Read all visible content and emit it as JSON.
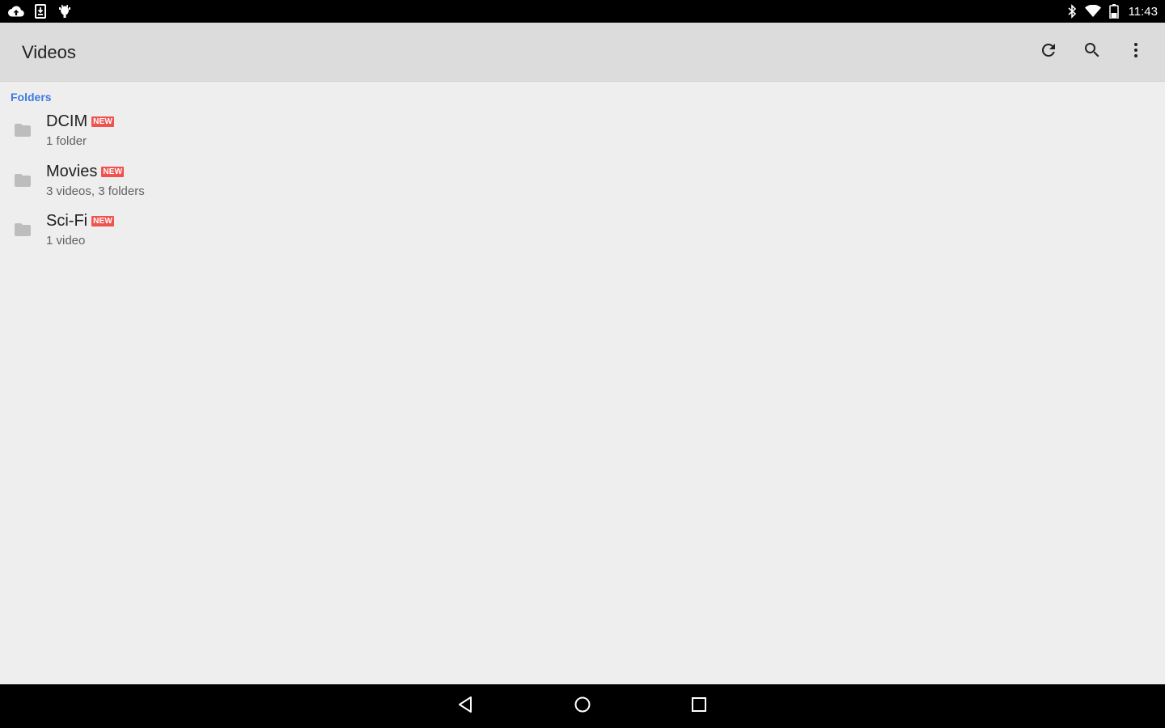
{
  "status_bar": {
    "time": "11:43",
    "left_icons": [
      "cloud-upload-icon",
      "download-icon",
      "android-debug-icon"
    ],
    "right_icons": [
      "bluetooth-icon",
      "wifi-icon",
      "battery-icon"
    ]
  },
  "app_bar": {
    "title": "Videos",
    "actions": [
      "refresh-icon",
      "search-icon",
      "more-vert-icon"
    ]
  },
  "folders_section": {
    "header": "Folders",
    "header_color": "#3d7be0",
    "items": [
      {
        "name": "DCIM",
        "badge": "NEW",
        "subtitle": "1 folder"
      },
      {
        "name": "Movies",
        "badge": "NEW",
        "subtitle": "3 videos, 3 folders"
      },
      {
        "name": "Sci-Fi",
        "badge": "NEW",
        "subtitle": "1 video"
      }
    ]
  },
  "nav_bar": {
    "buttons": [
      "back-icon",
      "home-icon",
      "recents-icon"
    ]
  },
  "colors": {
    "badge": "#ef5350",
    "app_bar_bg": "#dcdcdc",
    "content_bg": "#eeeeee",
    "folder_icon": "#bdbdbd"
  }
}
